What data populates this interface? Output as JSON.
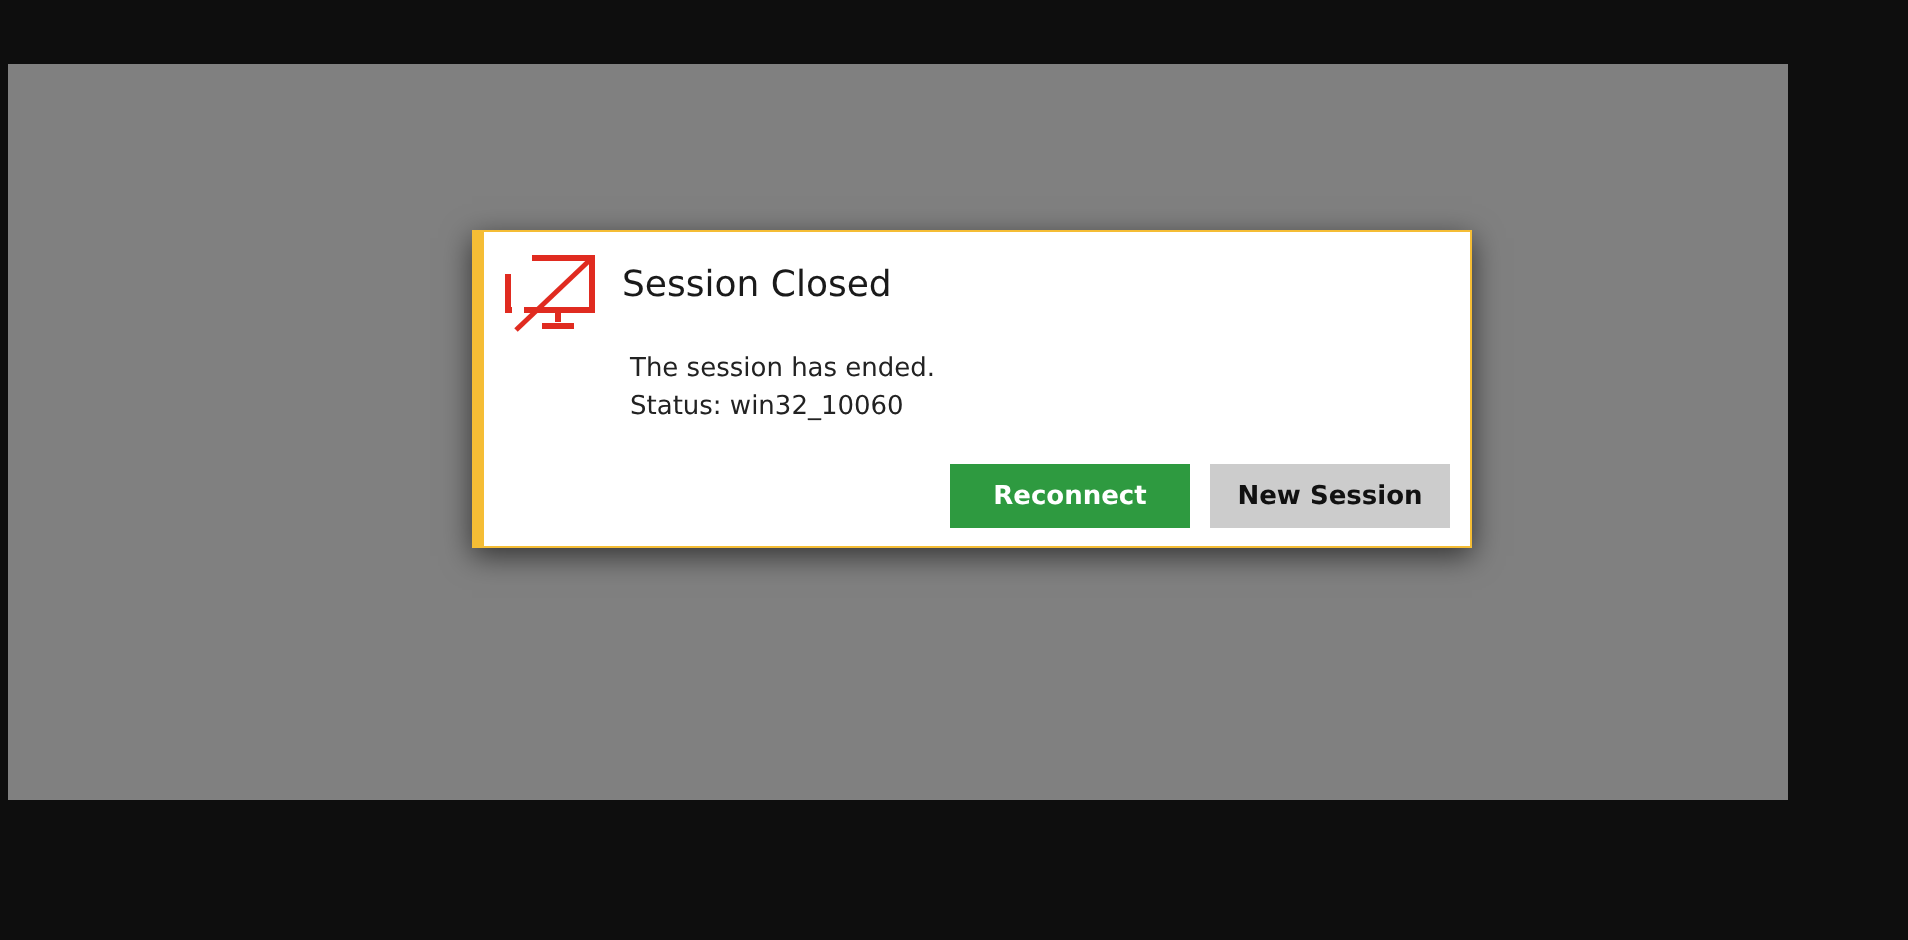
{
  "dialog": {
    "title": "Session Closed",
    "message": "The session has ended.",
    "status": "Status: win32_10060"
  },
  "buttons": [
    {
      "label": "Reconnect",
      "kind": "primary"
    },
    {
      "label": "New Session",
      "kind": "secondary"
    }
  ]
}
